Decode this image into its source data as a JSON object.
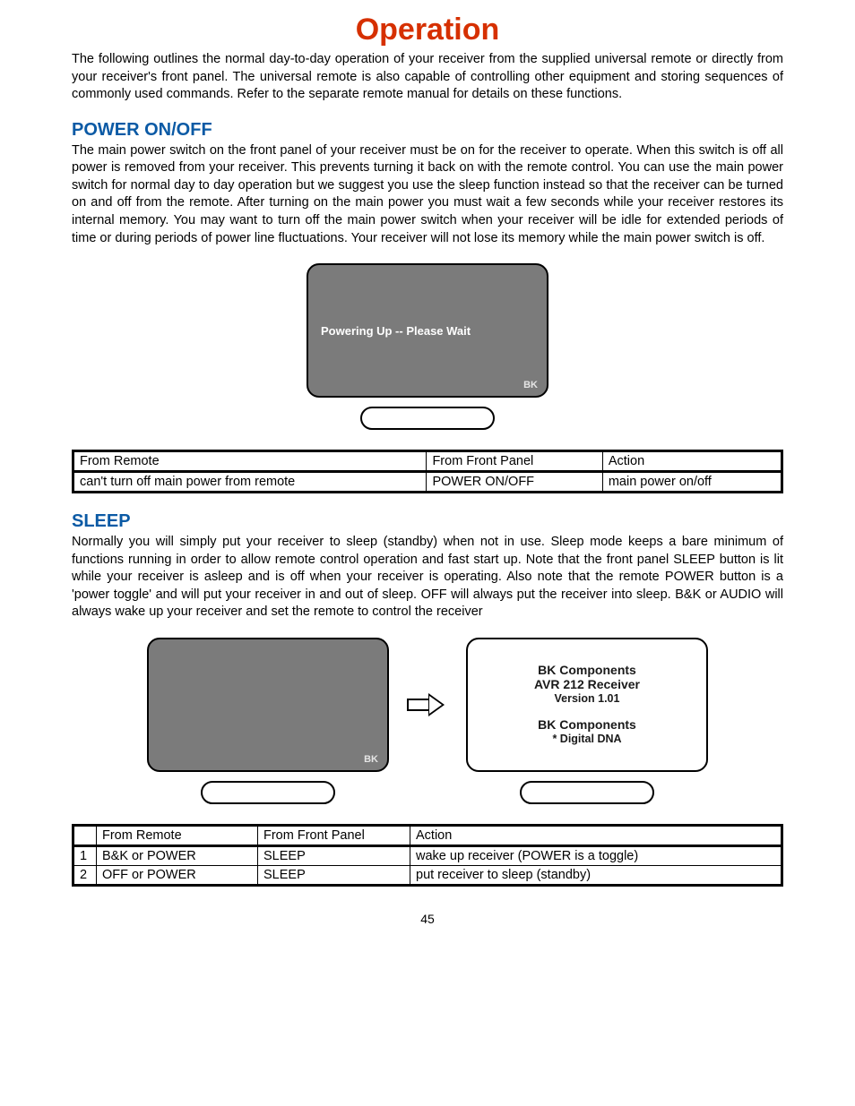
{
  "title": "Operation",
  "intro": "The following outlines the normal day-to-day operation of your receiver from the supplied universal remote or directly from your receiver's front panel. The universal remote is also capable of controlling other equipment and storing sequences of commonly used commands. Refer to the separate remote manual for details on these functions.",
  "power": {
    "heading": "POWER ON/OFF",
    "body": "The main power switch on the front panel of your receiver must be on for the receiver to operate. When this switch is off all power is removed from your receiver. This prevents turning it back on with the remote control. You can use the main power switch for normal day to day operation but we suggest you use the sleep function instead so that the receiver can be turned on and off from the remote. After turning on the main power you must wait a few seconds while your receiver restores its internal memory. You may want to turn off the main power switch when your receiver will be idle for extended periods of time or during periods of power line fluctuations. Your receiver will not lose its memory while the main power switch is off.",
    "screen_text": "Powering Up -- Please Wait",
    "bk": "BK",
    "table": {
      "headers": [
        "From Remote",
        "From Front Panel",
        "Action"
      ],
      "rows": [
        [
          "can't turn off main power from remote",
          "POWER ON/OFF",
          "main power on/off"
        ]
      ]
    }
  },
  "sleep": {
    "heading": "SLEEP",
    "body": "Normally you will simply put your receiver to sleep (standby) when not in use. Sleep mode keeps a bare minimum of functions running in order to allow remote control operation and fast start up. Note that the front panel SLEEP button is lit while your receiver is asleep and is off when your receiver is operating. Also note that the remote POWER button is a 'power toggle' and will put your receiver in and out of sleep. OFF will always put the receiver into sleep. B&K or AUDIO will always wake up your receiver and set the remote to control the receiver",
    "right_screen": {
      "line1": "BK Components",
      "line2": "AVR 212 Receiver",
      "line3": "Version 1.01",
      "line4": "BK Components",
      "line5": "* Digital DNA"
    },
    "bk": "BK",
    "table": {
      "headers": [
        "",
        "From Remote",
        "From Front Panel",
        "Action"
      ],
      "rows": [
        [
          "1",
          "B&K or POWER",
          "SLEEP",
          "wake up receiver (POWER is a toggle)"
        ],
        [
          "2",
          "OFF or POWER",
          "SLEEP",
          "put receiver to sleep (standby)"
        ]
      ]
    }
  },
  "page_number": "45"
}
